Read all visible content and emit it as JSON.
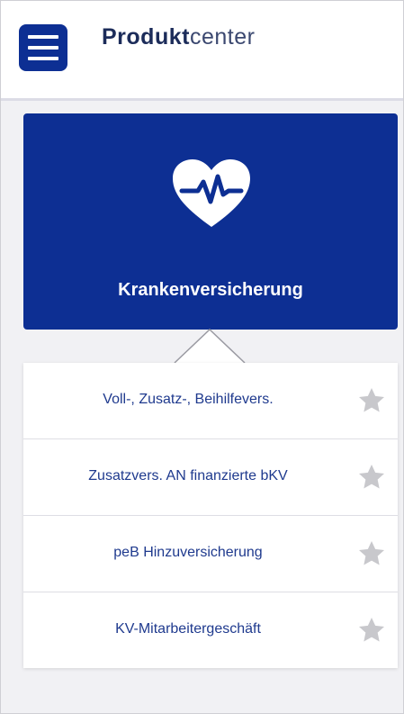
{
  "header": {
    "title_bold": "Produkt",
    "title_light": "center"
  },
  "category": {
    "label": "Krankenversicherung",
    "icon": "heart-pulse-icon",
    "color": "#0d2f93"
  },
  "items": [
    {
      "label": "Voll-, Zusatz-, Beihilfevers.",
      "favorite": false
    },
    {
      "label": "Zusatzvers. AN finanzierte bKV",
      "favorite": false
    },
    {
      "label": "peB Hinzuversicherung",
      "favorite": false
    },
    {
      "label": "KV-Mitarbeitergeschäft",
      "favorite": false
    }
  ],
  "colors": {
    "brand": "#0d2f93",
    "item_text": "#1f3a8e",
    "star_inactive": "#c8c8cc"
  }
}
